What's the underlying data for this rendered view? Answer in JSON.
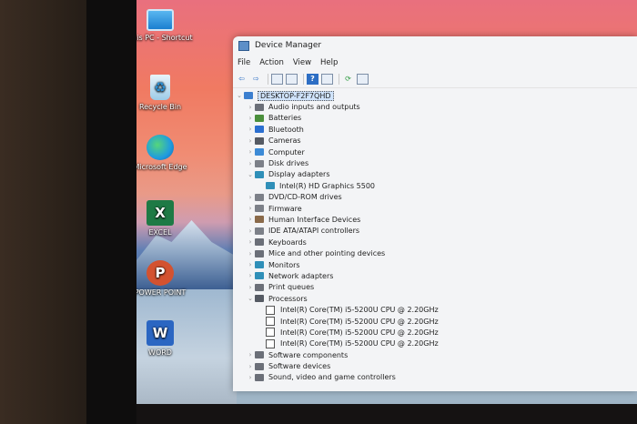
{
  "desktop": {
    "icons": [
      {
        "label": "This PC - Shortcut",
        "icon": "computer-icon"
      },
      {
        "label": "Recycle Bin",
        "icon": "recycle-bin-icon"
      },
      {
        "label": "Microsoft Edge",
        "icon": "edge-icon"
      },
      {
        "label": "EXCEL",
        "icon": "excel-icon"
      },
      {
        "label": "POWER POINT",
        "icon": "powerpoint-icon"
      },
      {
        "label": "WORD",
        "icon": "word-icon"
      }
    ]
  },
  "window": {
    "title": "Device Manager",
    "menu": [
      "File",
      "Action",
      "View",
      "Help"
    ],
    "toolbar": [
      "back-icon",
      "forward-icon",
      "properties-icon",
      "grid-icon",
      "help-icon",
      "details-icon",
      "update-driver-icon",
      "monitor-icon"
    ],
    "tree": {
      "root": "DESKTOP-F2F7QHD",
      "categories": [
        {
          "label": "Audio inputs and outputs",
          "icon": "speaker-icon",
          "color": "#6b6f78",
          "expanded": false
        },
        {
          "label": "Batteries",
          "icon": "battery-icon",
          "color": "#4a8f3c",
          "expanded": false
        },
        {
          "label": "Bluetooth",
          "icon": "bluetooth-icon",
          "color": "#2b6fd0",
          "expanded": false
        },
        {
          "label": "Cameras",
          "icon": "camera-icon",
          "color": "#555a63",
          "expanded": false
        },
        {
          "label": "Computer",
          "icon": "computer-icon",
          "color": "#3c8ad6",
          "expanded": false
        },
        {
          "label": "Disk drives",
          "icon": "disk-icon",
          "color": "#7c8088",
          "expanded": false
        },
        {
          "label": "Display adapters",
          "icon": "display-icon",
          "color": "#2f8fb8",
          "expanded": true,
          "children": [
            "Intel(R) HD Graphics 5500"
          ]
        },
        {
          "label": "DVD/CD-ROM drives",
          "icon": "dvd-icon",
          "color": "#7c8088",
          "expanded": false
        },
        {
          "label": "Firmware",
          "icon": "firmware-icon",
          "color": "#7c8088",
          "expanded": false
        },
        {
          "label": "Human Interface Devices",
          "icon": "hid-icon",
          "color": "#8a6a4a",
          "expanded": false
        },
        {
          "label": "IDE ATA/ATAPI controllers",
          "icon": "ide-icon",
          "color": "#7c8088",
          "expanded": false
        },
        {
          "label": "Keyboards",
          "icon": "keyboard-icon",
          "color": "#6b6f78",
          "expanded": false
        },
        {
          "label": "Mice and other pointing devices",
          "icon": "mouse-icon",
          "color": "#6b6f78",
          "expanded": false
        },
        {
          "label": "Monitors",
          "icon": "monitor-icon",
          "color": "#2f8fb8",
          "expanded": false
        },
        {
          "label": "Network adapters",
          "icon": "network-icon",
          "color": "#2f8fb8",
          "expanded": false
        },
        {
          "label": "Print queues",
          "icon": "printer-icon",
          "color": "#6b6f78",
          "expanded": false
        },
        {
          "label": "Processors",
          "icon": "processor-icon",
          "color": "#555a63",
          "expanded": true,
          "children": [
            "Intel(R) Core(TM) i5-5200U CPU @ 2.20GHz",
            "Intel(R) Core(TM) i5-5200U CPU @ 2.20GHz",
            "Intel(R) Core(TM) i5-5200U CPU @ 2.20GHz",
            "Intel(R) Core(TM) i5-5200U CPU @ 2.20GHz"
          ]
        },
        {
          "label": "Software components",
          "icon": "software-icon",
          "color": "#6b6f78",
          "expanded": false
        },
        {
          "label": "Software devices",
          "icon": "software-icon",
          "color": "#6b6f78",
          "expanded": false
        },
        {
          "label": "Sound, video and game controllers",
          "icon": "sound-icon",
          "color": "#6b6f78",
          "expanded": false
        }
      ]
    }
  }
}
